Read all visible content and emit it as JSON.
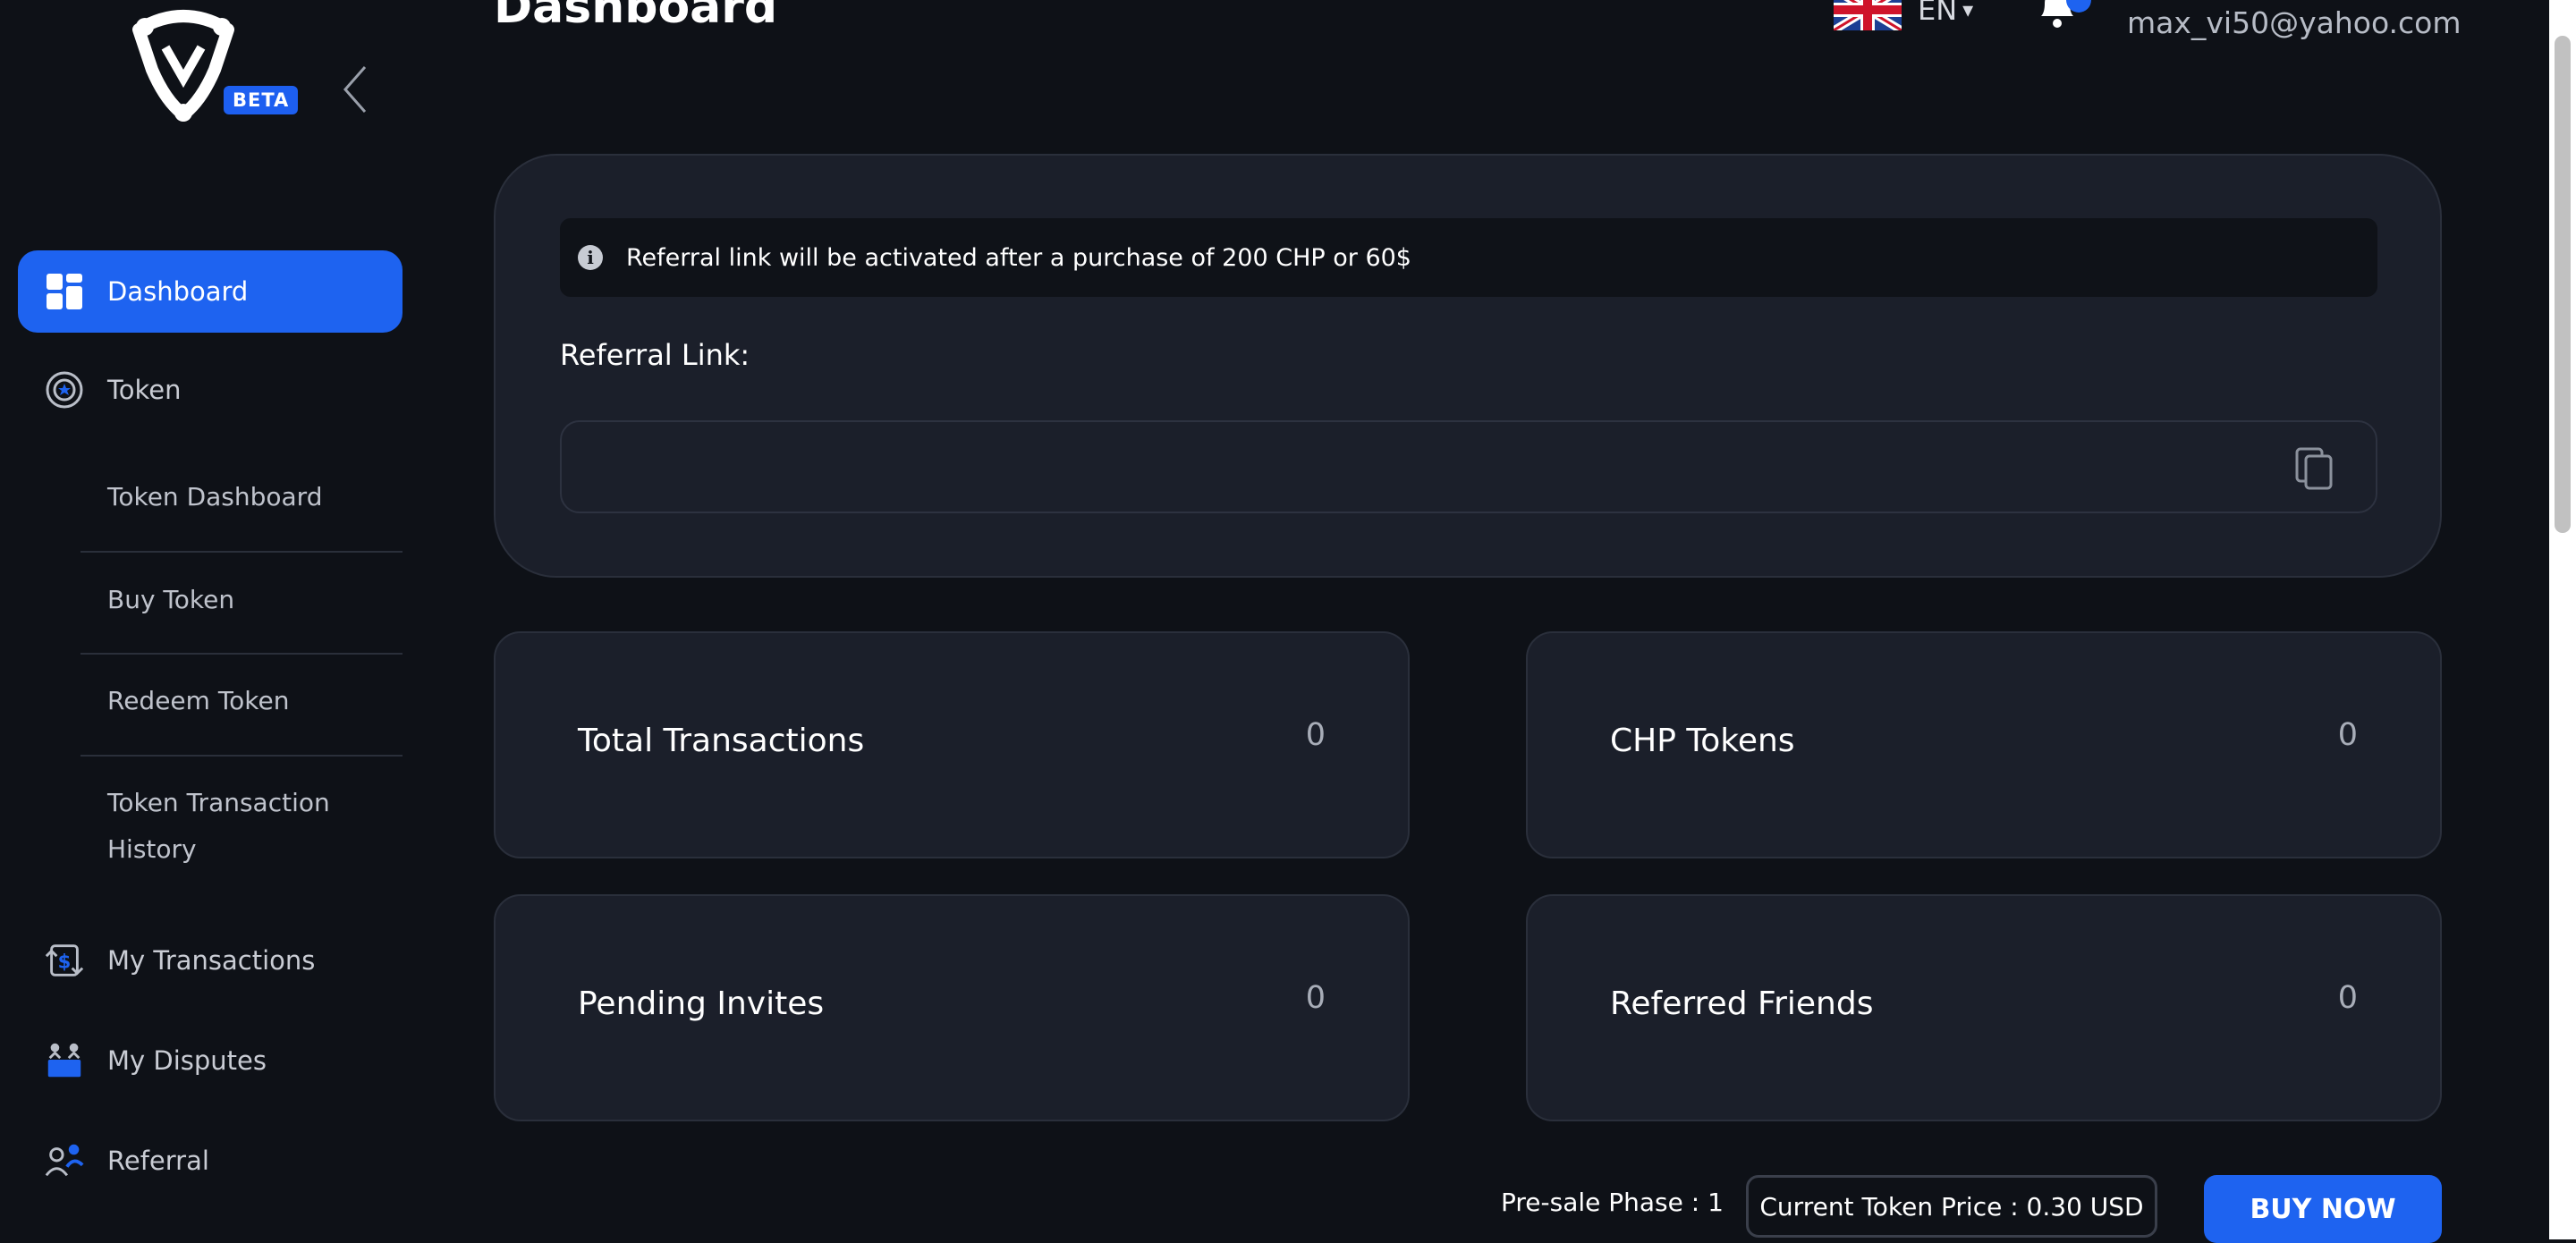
{
  "brand": {
    "badge": "BETA"
  },
  "header": {
    "title": "Dashboard",
    "language": "EN",
    "language_caret": "▾",
    "user_email": "max_vi50@yahoo.com"
  },
  "sidebar": {
    "items": [
      {
        "label": "Dashboard",
        "icon": "dashboard-icon",
        "active": true
      },
      {
        "label": "Token",
        "icon": "token-icon",
        "active": false
      },
      {
        "label": "My Transactions",
        "icon": "transactions-icon",
        "active": false
      },
      {
        "label": "My Disputes",
        "icon": "disputes-icon",
        "active": false
      },
      {
        "label": "Referral",
        "icon": "referral-icon",
        "active": false
      }
    ],
    "token_subitems": [
      {
        "label": "Token Dashboard"
      },
      {
        "label": "Buy Token"
      },
      {
        "label": "Redeem Token"
      },
      {
        "label": "Token Transaction History"
      }
    ]
  },
  "referral": {
    "notice": "Referral link will be activated after a purchase of 200 CHP or 60$",
    "label": "Referral Link:",
    "link_value": ""
  },
  "stats": [
    {
      "label": "Total Transactions",
      "value": "0"
    },
    {
      "label": "CHP Tokens",
      "value": "0"
    },
    {
      "label": "Pending Invites",
      "value": "0"
    },
    {
      "label": "Referred Friends",
      "value": "0"
    }
  ],
  "footer": {
    "presale": "Pre-sale Phase : 1",
    "price": "Current Token Price : 0.30 USD",
    "buy_label": "BUY NOW"
  },
  "colors": {
    "background": "#0e1117",
    "panel": "#1b1f2a",
    "accent": "#1e63f0"
  }
}
